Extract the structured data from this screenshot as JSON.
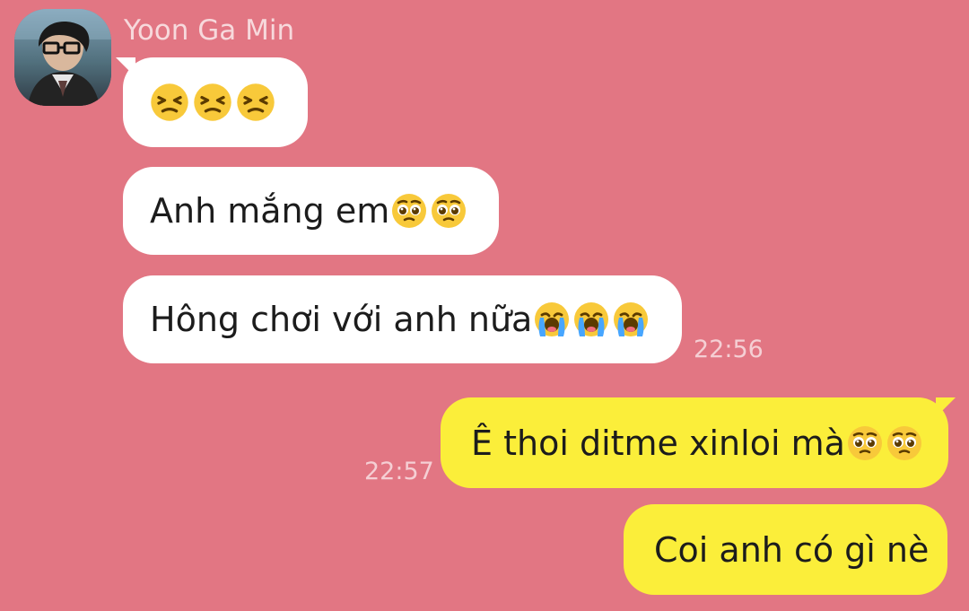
{
  "contact": {
    "name": "Yoon Ga Min"
  },
  "messages": [
    {
      "text": "",
      "emojis": [
        "tired-face-emoji",
        "tired-face-emoji",
        "tired-face-emoji"
      ]
    },
    {
      "text": "Anh mắng em",
      "emojis": [
        "pleading-face-emoji",
        "pleading-face-emoji"
      ]
    },
    {
      "text": "Hông chơi với anh nữa",
      "emojis": [
        "loudly-crying-face-emoji",
        "loudly-crying-face-emoji",
        "loudly-crying-face-emoji"
      ]
    },
    {
      "text": "Ê thoi ditme xinloi mà",
      "emojis": [
        "pleading-face-emoji",
        "pleading-face-emoji"
      ]
    },
    {
      "text": "Coi anh có gì nè",
      "emojis": []
    }
  ],
  "timestamps": {
    "first": "22:56",
    "second": "22:57"
  },
  "colors": {
    "background": "#e27683",
    "incoming_bubble": "#ffffff",
    "outgoing_bubble": "#fbee3a",
    "text": "#1c1c1c"
  }
}
